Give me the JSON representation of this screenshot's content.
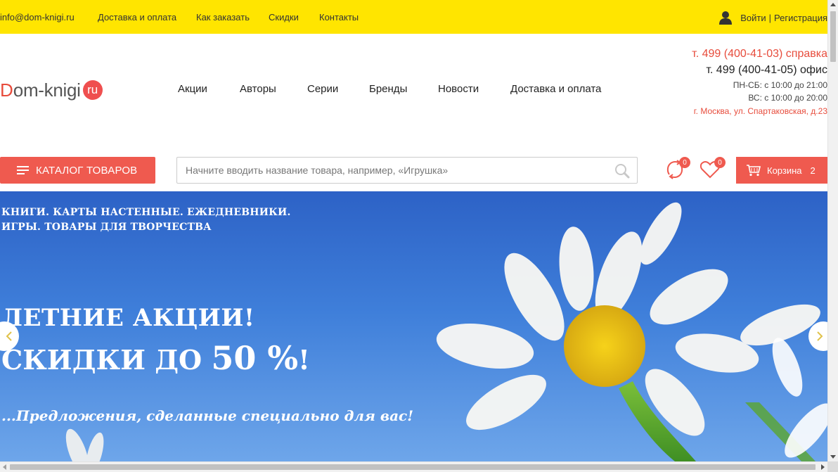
{
  "topbar": {
    "email": "info@dom-knigi.ru",
    "links": [
      "Доставка и оплата",
      "Как заказать",
      "Скидки",
      "Контакты"
    ],
    "login": "Войти",
    "separator": "|",
    "register": "Регистрация",
    "background": "#ffe500"
  },
  "logo": {
    "first_letter": "D",
    "rest": "om-knigi",
    "badge": "ru"
  },
  "nav": {
    "items": [
      "Акции",
      "Авторы",
      "Серии",
      "Бренды",
      "Новости",
      "Доставка и оплата"
    ]
  },
  "contacts": {
    "phone_help": "т. 499 (400-41-03) справка",
    "phone_office": "т. 499 (400-41-05) офис",
    "hours_weekdays": "ПН-СБ: с 10:00 до 21:00",
    "hours_sunday": "ВС: с 10:00 до 20:00",
    "address": "г. Москва, ул. Спартаковская, д.23"
  },
  "catalog_button": {
    "label": "КАТАЛОГ ТОВАРОВ",
    "icon": "menu-icon"
  },
  "search": {
    "placeholder": "Начните вводить название товара, например, «Игрушка»",
    "value": "",
    "icon": "search-icon"
  },
  "compare": {
    "icon": "compare-icon",
    "count": "0"
  },
  "favorites": {
    "icon": "heart-icon",
    "count": "0"
  },
  "cart": {
    "icon": "cart-icon",
    "label": "Корзина",
    "count": "2"
  },
  "hero": {
    "categories_line1": "КНИГИ. КАРТЫ НАСТЕННЫЕ. ЕЖЕДНЕВНИКИ.",
    "categories_line2": "ИГРЫ. ТОВАРЫ ДЛЯ ТВОРЧЕСТВА",
    "headline": "ЛЕТНИЕ АКЦИИ!",
    "discount_prefix": "СКИДКИ ДО ",
    "discount_value": "50 %",
    "discount_suffix": "!",
    "tagline": "...Предложения, сделанные специально для вас!"
  },
  "colors": {
    "accent": "#ef5a4f",
    "accent_text": "#e74c3c",
    "topbar": "#ffe500"
  }
}
